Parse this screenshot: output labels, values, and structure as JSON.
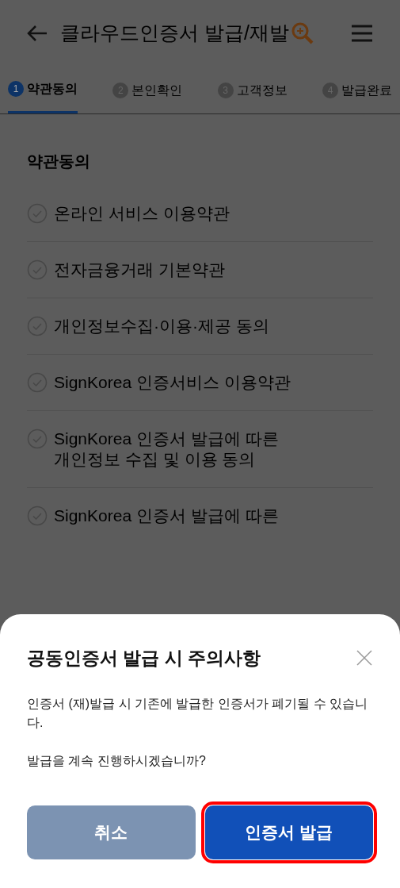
{
  "header": {
    "title": "클라우드인증서 발급/재발"
  },
  "steps": [
    {
      "number": "1",
      "label": "약관동의",
      "selected": true
    },
    {
      "number": "2",
      "label": "본인확인",
      "selected": false
    },
    {
      "number": "3",
      "label": "고객정보",
      "selected": false
    },
    {
      "number": "4",
      "label": "발급완료",
      "selected": false
    }
  ],
  "section_title": "약관동의",
  "terms": [
    {
      "text": "온라인 서비스 이용약관"
    },
    {
      "text": "전자금융거래 기본약관"
    },
    {
      "text": "개인정보수집·이용·제공 동의"
    },
    {
      "text": "SignKorea 인증서비스 이용약관"
    },
    {
      "text": "SignKorea 인증서 발급에 따른\n개인정보 수집 및 이용 동의"
    },
    {
      "text": "SignKorea 인증서 발급에 따른"
    }
  ],
  "dialog": {
    "title": "공동인증서 발급 시 주의사항",
    "message": "인증서 (재)발급 시 기존에 발급한 인증서가 폐기될 수 있습니다.",
    "question": "발급을 계속 진행하시겠습니까?",
    "buttons": [
      {
        "label": "취소",
        "kind": "secondary",
        "highlighted": false
      },
      {
        "label": "인증서 발급",
        "kind": "primary",
        "highlighted": true
      }
    ]
  }
}
